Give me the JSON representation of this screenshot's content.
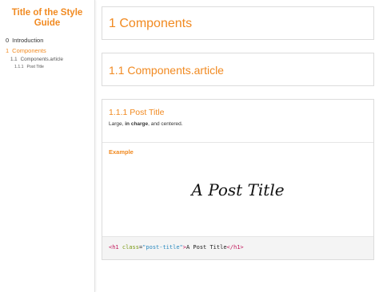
{
  "sidebar": {
    "title": "Title of the Style Guide",
    "nav": [
      {
        "num": "0",
        "label": "Introduction"
      },
      {
        "num": "1",
        "label": "Components"
      },
      {
        "num": "1.1",
        "label": "Components.article"
      },
      {
        "num": "1.1.1",
        "label": "Post Title"
      }
    ]
  },
  "sections": {
    "s1": {
      "num": "1",
      "title": "Components"
    },
    "s11": {
      "num": "1.1",
      "title": "Components.article"
    },
    "s111": {
      "num": "1.1.1",
      "title": "Post Title",
      "desc_pre": "Large, ",
      "desc_bold": "in charge",
      "desc_post": ", and centered.",
      "example_label": "Example",
      "example_text": "A Post Title",
      "code": {
        "open_tag": "<h1",
        "attr": "class",
        "eq": "=",
        "value": "\"post-title\"",
        "close_open": ">",
        "text": "A Post Title",
        "close_tag": "</h1>"
      }
    }
  },
  "colors": {
    "accent": "#f18a21"
  }
}
